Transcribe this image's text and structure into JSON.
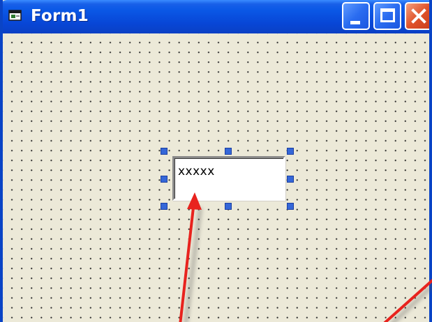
{
  "window": {
    "title": "Form1",
    "icon": "form-icon",
    "buttons": {
      "minimize": "minimize-icon",
      "maximize": "maximize-icon",
      "close": "close-icon"
    }
  },
  "form": {
    "textbox": {
      "text": "xxxxx",
      "selected": true
    }
  },
  "colors": {
    "title_bar": "#0a58e6",
    "form_background": "#ece9d8",
    "selection_handle": "#3567d8",
    "annotation_arrow": "#e8231e"
  }
}
